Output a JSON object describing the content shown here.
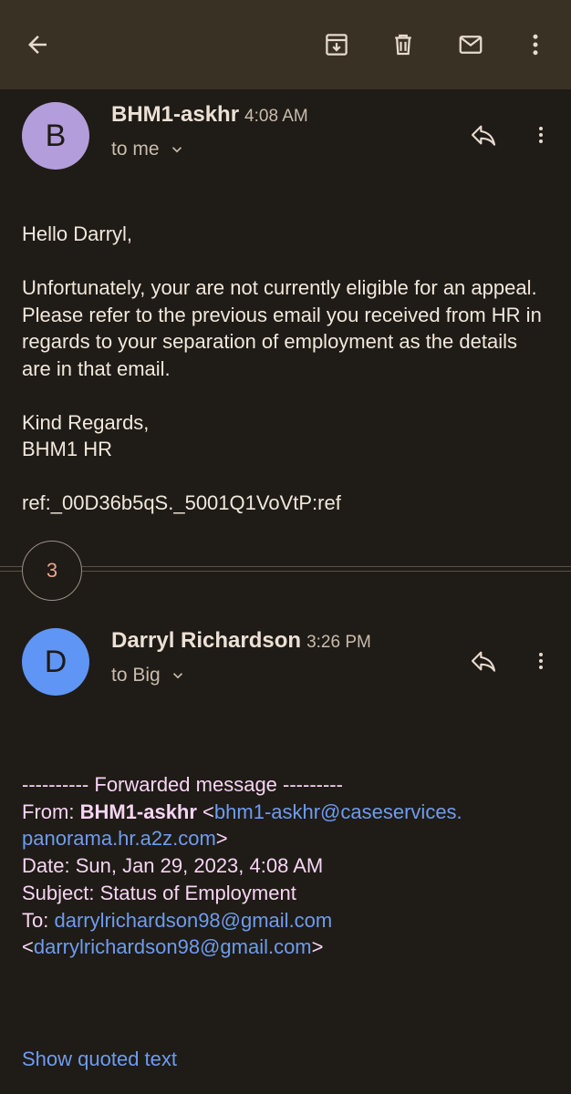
{
  "toolbar": {
    "back": "back-arrow-icon",
    "archive": "archive-icon",
    "delete": "trash-icon",
    "mark_unread": "mail-icon",
    "more": "more-vert-icon"
  },
  "messages": [
    {
      "avatar_letter": "B",
      "avatar_color": "#b39ddb",
      "sender": "BHM1-askhr",
      "time": "4:08 AM",
      "recipient": "to me",
      "body": {
        "greeting": "Hello Darryl,",
        "paragraph": "Unfortunately, your are not currently eligible for an appeal. Please refer to the previous email you received from HR in regards to your separation of employment as the details are in that email.",
        "closing_1": "Kind Regards,",
        "closing_2": "BHM1 HR",
        "ref": "ref:_00D36b5qS._5001Q1VoVtP:ref"
      }
    },
    {
      "avatar_letter": "D",
      "avatar_color": "#5f95f5",
      "sender": "Darryl Richardson",
      "time": "3:26 PM",
      "recipient": "to Big",
      "forwarded": {
        "header": "---------- Forwarded message ---------",
        "from_label": "From: ",
        "from_name": "BHM1-askhr",
        "from_email_open": " <",
        "from_email_1": "bhm1-askhr@caseservices.",
        "from_email_2": "panorama.hr.a2z.com",
        "from_email_close": ">",
        "date": "Date: Sun, Jan 29, 2023, 4:08 AM",
        "subject": "Subject: Status of Employment",
        "to_label": "To: ",
        "to_email": "darrylrichardson98@gmail.com",
        "to_email_open": "<",
        "to_email_2": "darrylrichardson98@gmail.com",
        "to_email_close": ">"
      }
    }
  ],
  "collapsed_count": "3",
  "show_quoted_text": "Show quoted text"
}
